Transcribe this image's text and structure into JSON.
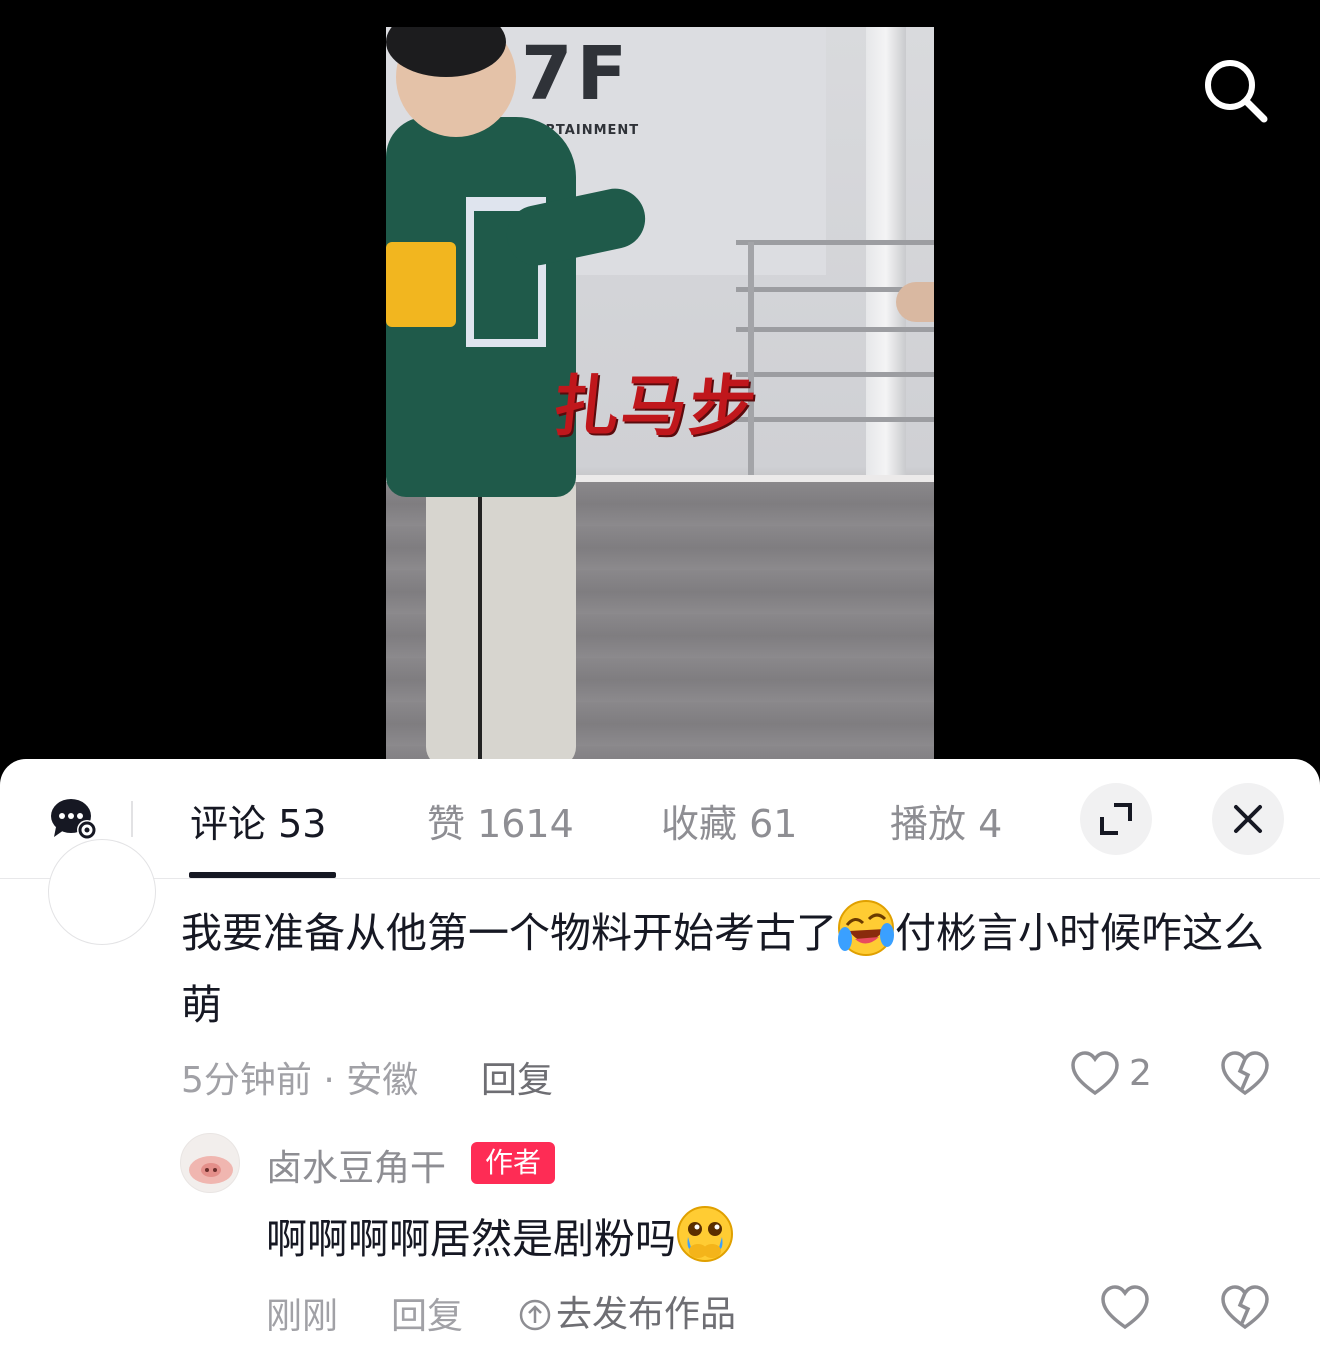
{
  "video": {
    "banner_logo": "7F",
    "banner_sub": "ENTERTAINMENT",
    "overlay_caption": "扎马步"
  },
  "top": {
    "search_icon": "search-icon"
  },
  "tabs": [
    {
      "label": "评论 53",
      "active": true
    },
    {
      "label": "赞 1614",
      "active": false
    },
    {
      "label": "收藏 61",
      "active": false
    },
    {
      "label": "播放 4",
      "active": false
    }
  ],
  "controls": {
    "expand_icon": "expand-icon",
    "close_icon": "close-icon",
    "chat_icon": "chat-settings-icon"
  },
  "comment": {
    "text_before_emoji": "我要准备从他第一个物料开始考古了",
    "emoji": "laughing-tears-emoji",
    "text_after_emoji": "付彬言小时候咋这么萌",
    "time_location": "5分钟前 · 安徽",
    "reply_label": "回复",
    "like_count": "2"
  },
  "reply": {
    "username": "卤水豆角干",
    "badge": "作者",
    "text": "啊啊啊啊居然是剧粉吗",
    "emoji": "crying-face-emoji",
    "time": "刚刚",
    "reply_label": "回复",
    "publish_label": "去发布作品"
  },
  "colors": {
    "accent": "#fe2c55",
    "text": "#161823",
    "muted": "#8e8e93",
    "caption_red": "#c0171c"
  }
}
